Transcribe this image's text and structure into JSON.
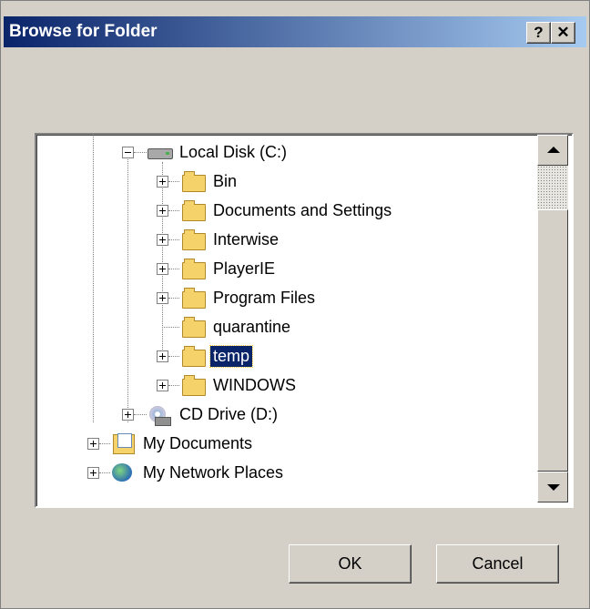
{
  "window": {
    "title": "Browse for Folder",
    "help_label": "?",
    "close_label": "✕"
  },
  "tree": {
    "local_disk": "Local Disk (C:)",
    "folders": [
      "Bin",
      "Documents and Settings",
      "Interwise",
      "PlayerIE",
      "Program Files",
      "quarantine",
      "temp",
      "WINDOWS"
    ],
    "selected": "temp",
    "cd_drive": "CD Drive (D:)",
    "my_documents": "My Documents",
    "my_network_places": "My Network Places"
  },
  "buttons": {
    "ok": "OK",
    "cancel": "Cancel"
  }
}
